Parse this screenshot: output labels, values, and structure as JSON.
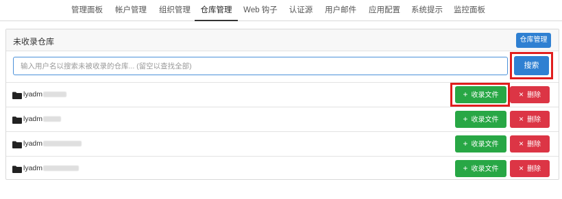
{
  "nav": {
    "items": [
      {
        "label": "管理面板",
        "active": false
      },
      {
        "label": "帐户管理",
        "active": false
      },
      {
        "label": "组织管理",
        "active": false
      },
      {
        "label": "仓库管理",
        "active": true
      },
      {
        "label": "Web 钩子",
        "active": false
      },
      {
        "label": "认证源",
        "active": false
      },
      {
        "label": "用户邮件",
        "active": false
      },
      {
        "label": "应用配置",
        "active": false
      },
      {
        "label": "系统提示",
        "active": false
      },
      {
        "label": "监控面板",
        "active": false
      }
    ]
  },
  "panel": {
    "title": "未收录仓库",
    "manage_button": "仓库管理"
  },
  "search": {
    "placeholder": "输入用户名以搜索未被收录的仓库... (留空以查找全部)",
    "button": "搜索"
  },
  "repos": [
    {
      "name": "lyadm"
    },
    {
      "name": "lyadm"
    },
    {
      "name": "lyadm"
    },
    {
      "name": "lyadm"
    }
  ],
  "row_actions": {
    "collect_label": "收录文件",
    "collect_icon": "+",
    "delete_label": "删除",
    "delete_icon": "×"
  },
  "colors": {
    "primary": "#2f80d2",
    "success": "#28a745",
    "danger": "#dc3545",
    "highlight": "#e01d1d"
  }
}
